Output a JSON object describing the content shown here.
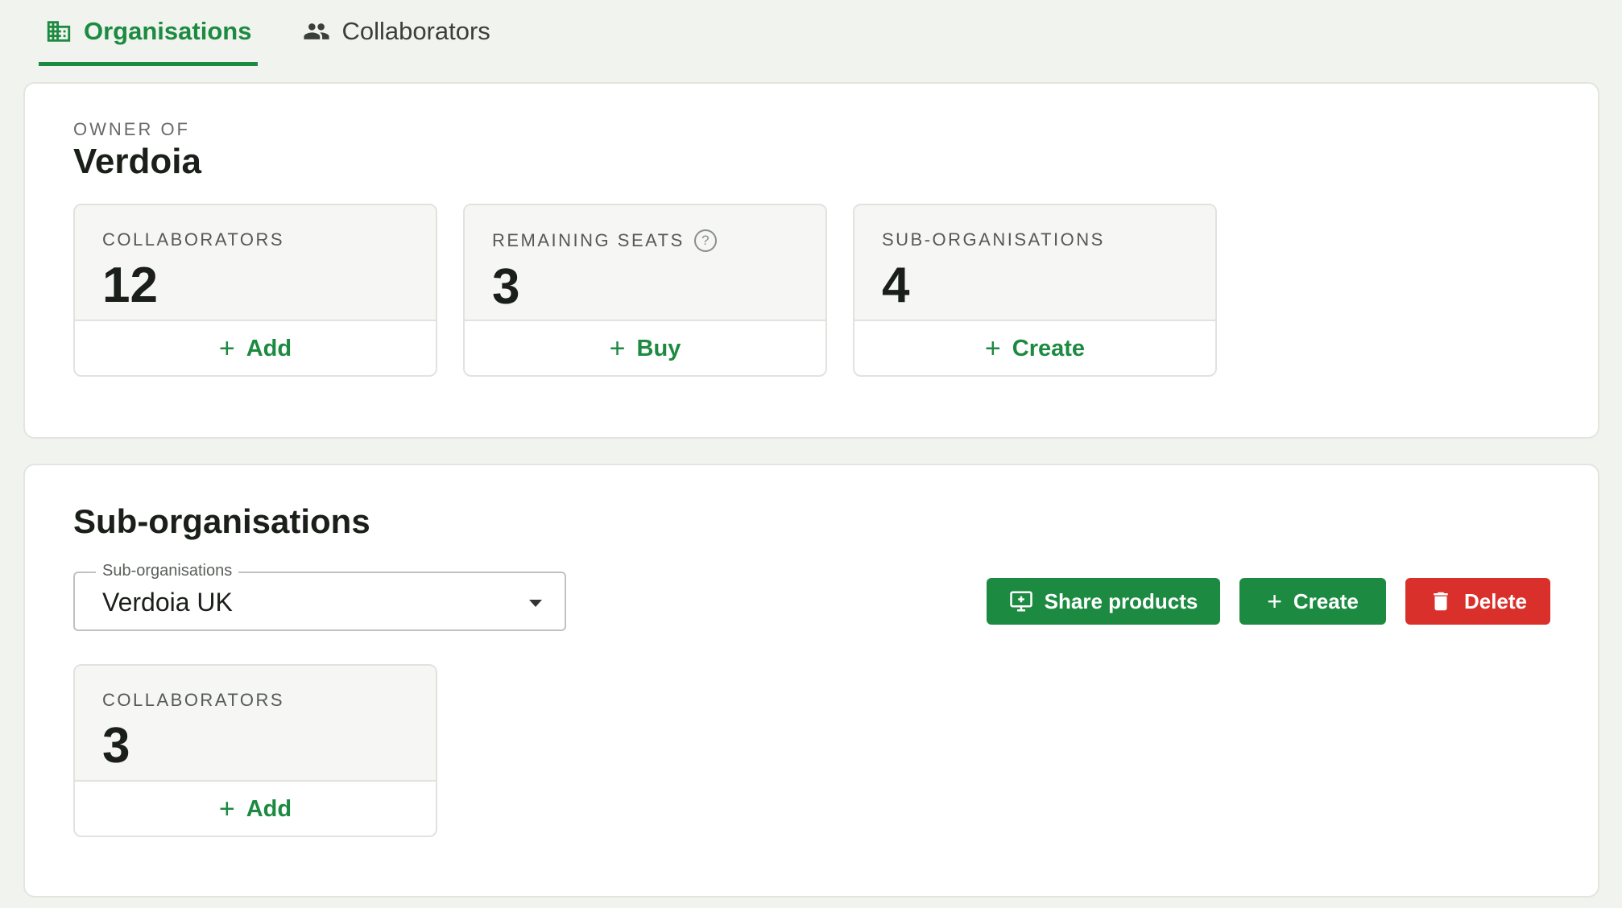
{
  "tabs": [
    {
      "label": "Organisations",
      "icon": "building-icon",
      "active": true
    },
    {
      "label": "Collaborators",
      "icon": "people-icon",
      "active": false
    }
  ],
  "owner": {
    "eyebrow": "OWNER OF",
    "name": "Verdoia",
    "stats": [
      {
        "label": "COLLABORATORS",
        "value": "12",
        "action": "Add"
      },
      {
        "label": "REMAINING SEATS",
        "value": "3",
        "action": "Buy",
        "help": "?"
      },
      {
        "label": "SUB-ORGANISATIONS",
        "value": "4",
        "action": "Create"
      }
    ]
  },
  "subs": {
    "title": "Sub-organisations",
    "select": {
      "legend": "Sub-organisations",
      "value": "Verdoia UK"
    },
    "buttons": {
      "share": "Share products",
      "create": "Create",
      "delete": "Delete"
    },
    "stat": {
      "label": "COLLABORATORS",
      "value": "3",
      "action": "Add"
    }
  },
  "colors": {
    "accent": "#1d8a42",
    "danger": "#d9302c",
    "background": "#f1f4ee"
  }
}
